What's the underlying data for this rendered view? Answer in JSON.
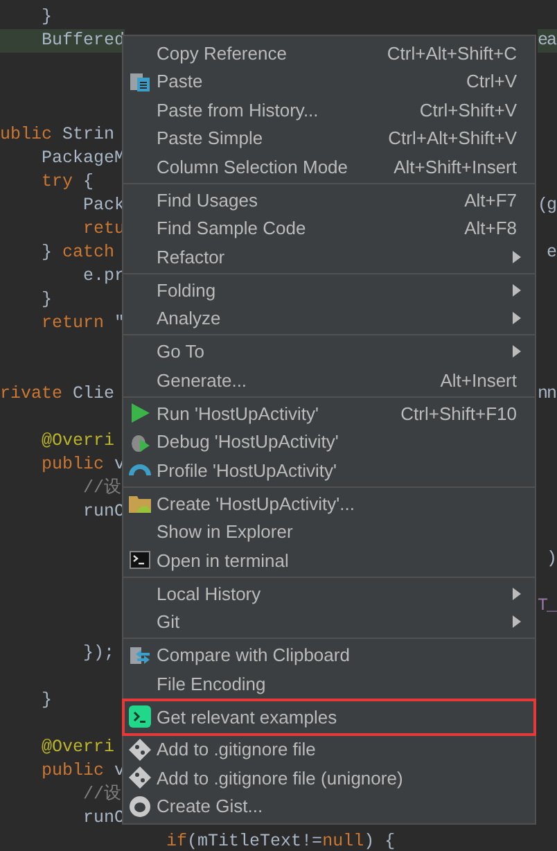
{
  "editor": {
    "lines": [
      {
        "kind": "code",
        "tokens": [
          {
            "text": "    }",
            "kind": "plain"
          }
        ]
      },
      {
        "kind": "code",
        "tokens": [
          {
            "text": "    Buffered",
            "kind": "plain"
          }
        ],
        "right": {
          "text": "ea",
          "kind": "plain"
        },
        "usage_highlight": true
      },
      {
        "kind": "blank"
      },
      {
        "kind": "blank"
      },
      {
        "kind": "blank"
      },
      {
        "kind": "code",
        "tokens": [
          {
            "text": "ublic",
            "kind": "keyword"
          },
          {
            "text": " Strin",
            "kind": "plain"
          }
        ]
      },
      {
        "kind": "code",
        "tokens": [
          {
            "text": "    PackageM",
            "kind": "plain"
          }
        ]
      },
      {
        "kind": "code",
        "tokens": [
          {
            "text": "    try",
            "kind": "keyword"
          },
          {
            "text": " {",
            "kind": "plain"
          }
        ]
      },
      {
        "kind": "code",
        "tokens": [
          {
            "text": "        Pack",
            "kind": "plain"
          }
        ],
        "right": {
          "text": "(g",
          "kind": "plain"
        }
      },
      {
        "kind": "code",
        "tokens": [
          {
            "text": "        retu",
            "kind": "keyword"
          }
        ]
      },
      {
        "kind": "code",
        "tokens": [
          {
            "text": "    } ",
            "kind": "plain"
          },
          {
            "text": "catch",
            "kind": "keyword"
          }
        ],
        "right": {
          "text": "e",
          "kind": "plain"
        }
      },
      {
        "kind": "code",
        "tokens": [
          {
            "text": "        e.pr",
            "kind": "plain"
          }
        ]
      },
      {
        "kind": "code",
        "tokens": [
          {
            "text": "    }",
            "kind": "plain"
          }
        ]
      },
      {
        "kind": "code",
        "tokens": [
          {
            "text": "    return",
            "kind": "keyword"
          },
          {
            "text": " \"",
            "kind": "plain"
          }
        ]
      },
      {
        "kind": "blank"
      },
      {
        "kind": "blank"
      },
      {
        "kind": "code",
        "tokens": [
          {
            "text": "rivate",
            "kind": "keyword"
          },
          {
            "text": " Clie",
            "kind": "plain"
          }
        ],
        "right": {
          "text": "nn",
          "kind": "plain"
        }
      },
      {
        "kind": "blank"
      },
      {
        "kind": "code",
        "tokens": [
          {
            "text": "    @Overri",
            "kind": "annotation"
          }
        ]
      },
      {
        "kind": "code",
        "tokens": [
          {
            "text": "    public",
            "kind": "keyword"
          },
          {
            "text": " v",
            "kind": "plain"
          }
        ]
      },
      {
        "kind": "code",
        "tokens": [
          {
            "text": "        //设",
            "kind": "comment"
          }
        ]
      },
      {
        "kind": "code",
        "tokens": [
          {
            "text": "        runO",
            "kind": "plain"
          }
        ]
      },
      {
        "kind": "blank"
      },
      {
        "kind": "code",
        "right": {
          "text": ")",
          "kind": "plain"
        }
      },
      {
        "kind": "blank"
      },
      {
        "kind": "code",
        "right": {
          "text": "T_",
          "kind": "field"
        }
      },
      {
        "kind": "blank"
      },
      {
        "kind": "code",
        "tokens": [
          {
            "text": "        });",
            "kind": "plain"
          }
        ]
      },
      {
        "kind": "blank"
      },
      {
        "kind": "code",
        "tokens": [
          {
            "text": "    }",
            "kind": "plain"
          }
        ]
      },
      {
        "kind": "blank"
      },
      {
        "kind": "code",
        "tokens": [
          {
            "text": "    @Overri",
            "kind": "annotation"
          }
        ]
      },
      {
        "kind": "code",
        "tokens": [
          {
            "text": "    public",
            "kind": "keyword"
          },
          {
            "text": " v",
            "kind": "plain"
          }
        ]
      },
      {
        "kind": "code",
        "tokens": [
          {
            "text": "        //设",
            "kind": "comment"
          }
        ]
      },
      {
        "kind": "code",
        "tokens": [
          {
            "text": "        runO",
            "kind": "plain"
          }
        ]
      },
      {
        "kind": "code",
        "tokens": [
          {
            "text": "                if",
            "kind": "keyword"
          },
          {
            "text": "(mTitleText!=",
            "kind": "plain"
          },
          {
            "text": "null",
            "kind": "keyword"
          },
          {
            "text": ") {",
            "kind": "plain"
          }
        ]
      }
    ]
  },
  "context_menu": {
    "groups": [
      [
        {
          "label": "Copy Reference",
          "shortcut": "Ctrl+Alt+Shift+C",
          "kind": "text",
          "submenu": false
        },
        {
          "label": "Paste",
          "shortcut": "Ctrl+V",
          "kind": "clipboard",
          "submenu": false
        },
        {
          "label": "Paste from History...",
          "shortcut": "Ctrl+Shift+V",
          "kind": "text",
          "submenu": false
        },
        {
          "label": "Paste Simple",
          "shortcut": "Ctrl+Alt+Shift+V",
          "kind": "text",
          "submenu": false
        },
        {
          "label": "Column Selection Mode",
          "shortcut": "Alt+Shift+Insert",
          "kind": "text",
          "submenu": false
        }
      ],
      [
        {
          "label": "Find Usages",
          "shortcut": "Alt+F7",
          "kind": "text",
          "submenu": false
        },
        {
          "label": "Find Sample Code",
          "shortcut": "Alt+F8",
          "kind": "text",
          "submenu": false
        },
        {
          "label": "Refactor",
          "kind": "text",
          "submenu": true
        }
      ],
      [
        {
          "label": "Folding",
          "kind": "text",
          "submenu": true
        },
        {
          "label": "Analyze",
          "kind": "text",
          "submenu": true
        }
      ],
      [
        {
          "label": "Go To",
          "kind": "text",
          "submenu": true
        },
        {
          "label": "Generate...",
          "shortcut": "Alt+Insert",
          "kind": "text",
          "submenu": false
        }
      ],
      [
        {
          "label": "Run 'HostUpActivity'",
          "shortcut": "Ctrl+Shift+F10",
          "kind": "run",
          "submenu": false
        },
        {
          "label": "Debug 'HostUpActivity'",
          "kind": "debug",
          "submenu": false
        },
        {
          "label": "Profile 'HostUpActivity'",
          "kind": "gauge",
          "submenu": false
        }
      ],
      [
        {
          "label": "Create 'HostUpActivity'...",
          "kind": "folder",
          "submenu": false
        },
        {
          "label": "Show in Explorer",
          "kind": "text",
          "submenu": false
        },
        {
          "label": "Open in terminal",
          "kind": "terminal",
          "submenu": false
        }
      ],
      [
        {
          "label": "Local History",
          "kind": "text",
          "submenu": true
        },
        {
          "label": "Git",
          "kind": "text",
          "submenu": true
        }
      ],
      [
        {
          "label": "Compare with Clipboard",
          "kind": "compare",
          "submenu": false
        },
        {
          "label": "File Encoding",
          "kind": "text",
          "submenu": false
        },
        {
          "label": "Get relevant examples",
          "kind": "examples",
          "submenu": false,
          "outlined": true
        },
        {
          "label": "Add to .gitignore file",
          "kind": "git",
          "submenu": false
        },
        {
          "label": "Add to .gitignore file (unignore)",
          "kind": "git",
          "submenu": false
        },
        {
          "label": "Create Gist...",
          "kind": "gist",
          "submenu": false
        }
      ]
    ]
  }
}
